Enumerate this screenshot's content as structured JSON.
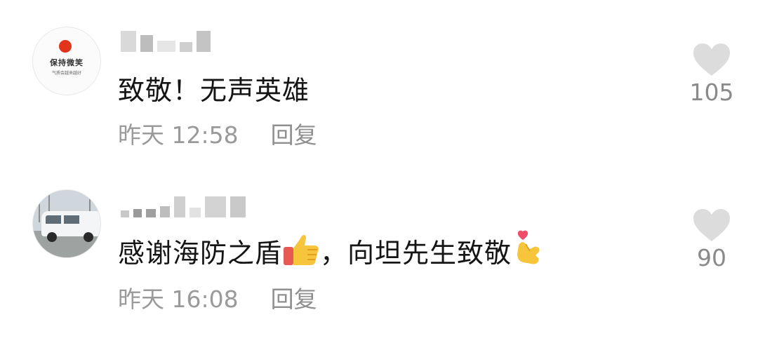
{
  "comments": [
    {
      "avatar_text_line1": "保持微笑",
      "avatar_text_line2": "气质会越来越好",
      "text": "致敬！无声英雄",
      "time": "昨天 12:58",
      "reply_label": "回复",
      "likes": "105"
    },
    {
      "text_before": "感谢海防之盾",
      "emoji_1": "thumbs-up-emoji",
      "text_after": "，向坦先生致敬",
      "emoji_2": "finger-heart-emoji",
      "time": "昨天 16:08",
      "reply_label": "回复",
      "likes": "90"
    }
  ],
  "colors": {
    "text": "#151515",
    "meta": "#9a9a9a",
    "heart": "#dcdcdc",
    "avatar_dot": "#e2341d"
  }
}
